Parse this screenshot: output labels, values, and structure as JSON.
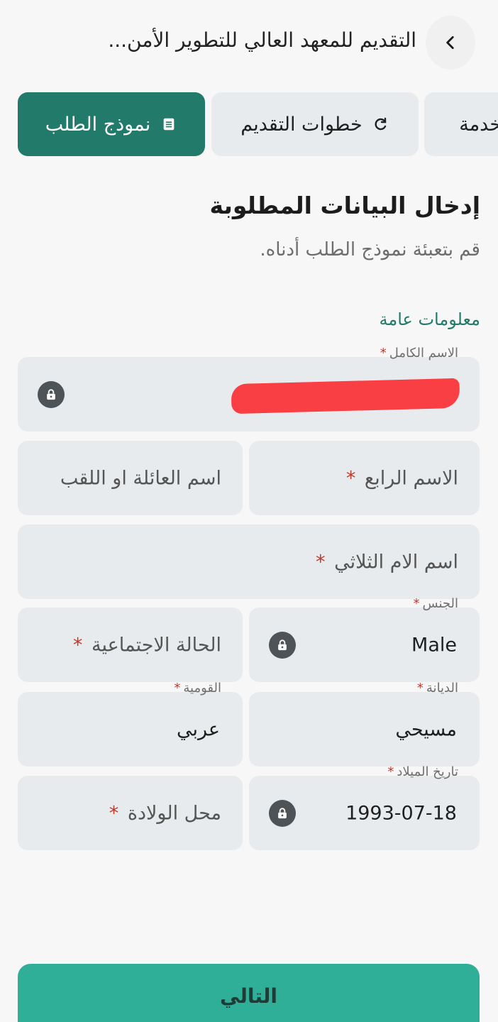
{
  "header": {
    "title": "التقديم للمعهد العالي للتطوير الأمن..."
  },
  "tabs": [
    {
      "label": "نموذج الطلب",
      "icon": "document-icon",
      "active": true
    },
    {
      "label": "خطوات التقديم",
      "icon": "refresh-icon",
      "active": false
    },
    {
      "label": "لخدمة",
      "icon": "",
      "active": false
    }
  ],
  "section": {
    "title": "إدخال البيانات المطلوبة",
    "subtitle": "قم بتعبئة نموذج الطلب أدناه.",
    "group_label": "معلومات عامة"
  },
  "fields": {
    "full_name": {
      "label": "الاسم الكامل",
      "value": "",
      "locked": true,
      "redacted": true
    },
    "fourth_name": {
      "placeholder": "الاسم الرابع",
      "required": true
    },
    "family_name": {
      "placeholder": "اسم العائلة او اللقب"
    },
    "mother_name": {
      "placeholder": "اسم الام الثلاثي",
      "required": true
    },
    "gender": {
      "label": "الجنس",
      "value": "Male",
      "locked": true
    },
    "marital_status": {
      "placeholder": "الحالة الاجتماعية",
      "required": true
    },
    "religion": {
      "label": "الديانة",
      "value": "مسيحي"
    },
    "nationality": {
      "label": "القومية",
      "value": "عربي"
    },
    "birth_date": {
      "label": "تاريخ الميلاد",
      "value": "1993-07-18",
      "locked": true
    },
    "birth_place": {
      "placeholder": "محل الولادة",
      "required": true
    }
  },
  "required_marker": "*",
  "next_button": {
    "label": "التالي"
  },
  "colors": {
    "primary": "#227a6b",
    "button": "#2fae98",
    "field_bg": "#e8ebed",
    "required": "#c0392b",
    "redaction": "#fa3f44"
  }
}
